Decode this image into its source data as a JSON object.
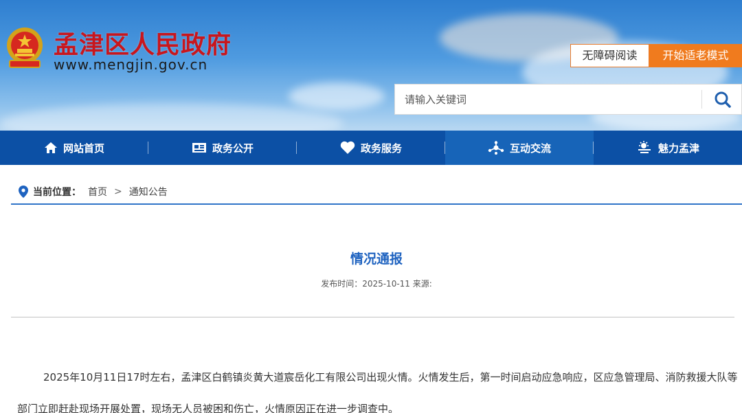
{
  "header": {
    "site_title": "孟津区人民政府",
    "site_url": "www.mengjin.gov.cn",
    "emblem_icon": "national-emblem-icon",
    "accessibility_button": "无障碍阅读",
    "elder_mode_button": "开始适老模式",
    "search": {
      "placeholder": "请输入关键词",
      "icon": "search-icon"
    }
  },
  "nav": {
    "items": [
      {
        "label": "网站首页",
        "icon": "home-icon"
      },
      {
        "label": "政务公开",
        "icon": "document-icon"
      },
      {
        "label": "政务服务",
        "icon": "heart-icon"
      },
      {
        "label": "互动交流",
        "icon": "network-icon"
      },
      {
        "label": "魅力孟津",
        "icon": "weather-icon"
      }
    ],
    "active_index": 3
  },
  "breadcrumb": {
    "label": "当前位置：",
    "items": [
      "首页",
      "通知公告"
    ],
    "separator": ">"
  },
  "article": {
    "title": "情况通报",
    "meta": "发布时间：2025-10-11 来源:",
    "body": "2025年10月11日17时左右，孟津区白鹤镇炎黄大道宸岳化工有限公司出现火情。火情发生后，第一时间启动应急响应，区应急管理局、消防救援大队等部门立即赶赴现场开展处置，现场无人员被困和伤亡，火情原因正在进一步调查中。"
  },
  "colors": {
    "title_red": "#c8161d",
    "nav_blue": "#0c50a5",
    "accent_orange": "#f07b1e",
    "article_title_blue": "#1f63c0"
  }
}
